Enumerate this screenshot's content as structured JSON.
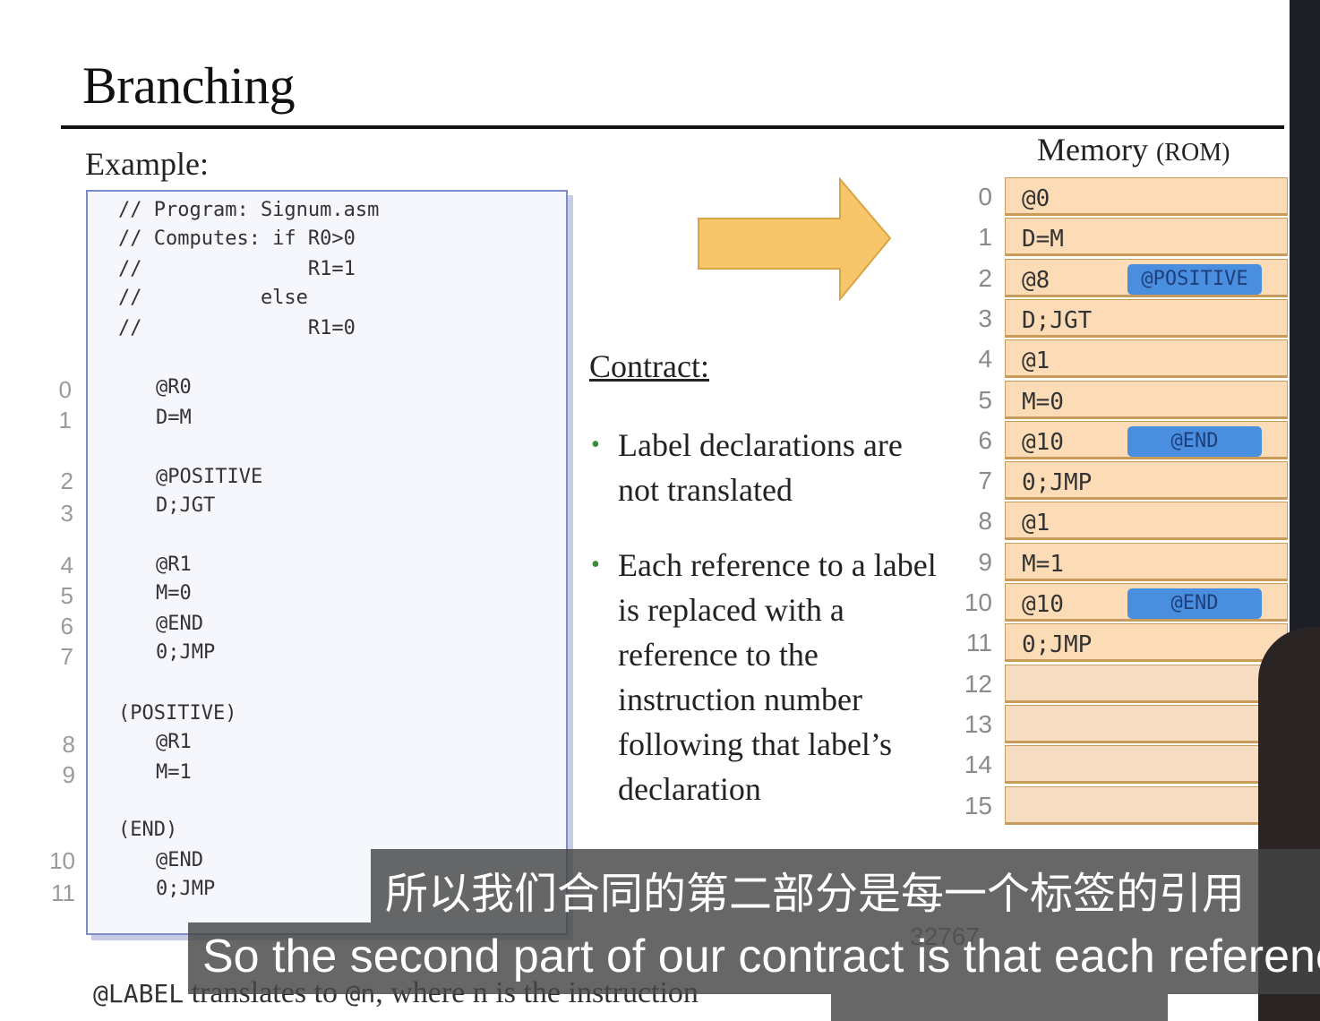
{
  "slide": {
    "title": "Branching",
    "example_label": "Example:",
    "code_lines": [
      "// Program: Signum.asm",
      "// Computes: if R0>0",
      "//              R1=1",
      "//          else",
      "//              R1=0",
      "@R0",
      "D=M",
      "@POSITIVE",
      "D;JGT",
      "@R1",
      "M=0",
      "@END",
      "0;JMP",
      "(POSITIVE)",
      "@R1",
      "M=1",
      "(END)",
      "@END",
      "0;JMP"
    ],
    "line_numbers": [
      "0",
      "1",
      "2",
      "3",
      "4",
      "5",
      "6",
      "7",
      "8",
      "9",
      "10",
      "11"
    ],
    "contract": {
      "heading": "Contract:",
      "bullets": [
        "Label declarations are not translated",
        "Each reference to a label is replaced with a reference to the instruction number following that label’s declaration"
      ]
    },
    "memory": {
      "title": "Memory",
      "title_suffix": "(ROM)",
      "addresses": [
        "0",
        "1",
        "2",
        "3",
        "4",
        "5",
        "6",
        "7",
        "8",
        "9",
        "10",
        "11",
        "12",
        "13",
        "14",
        "15"
      ],
      "values": [
        "@0",
        "D=M",
        "@8",
        "D;JGT",
        "@1",
        "M=0",
        "@10",
        "0;JMP",
        "@1",
        "M=1",
        "@10",
        "0;JMP",
        "",
        "",
        "",
        ""
      ],
      "tags": [
        {
          "row": 2,
          "label": "@POSITIVE"
        },
        {
          "row": 6,
          "label": "@END"
        },
        {
          "row": 10,
          "label": "@END"
        }
      ],
      "last_address": "32767"
    },
    "footnote": {
      "code1": "@LABEL",
      "text1": " translates to ",
      "code2": "@n",
      "text2": ", where n is the instruction"
    }
  },
  "subtitles": {
    "zh": "所以我们合同的第二部分是每一个标签的引用",
    "en": "So the second part of our contract is that each reference"
  },
  "colors": {
    "memory_cell": "#fbdcb6",
    "tag": "#4a8ee0",
    "arrow": "#f7c66b",
    "code_border": "#7d8bc9"
  }
}
